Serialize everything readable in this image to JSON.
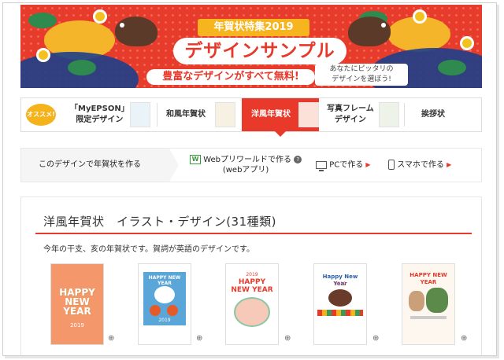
{
  "banner": {
    "tag": "年賀状特集2019",
    "title": "デザインサンプル",
    "subtitle": "豊富なデザインがすべて無料!",
    "note_line1": "あなたにピッタリの",
    "note_line2": "デザインを選ぼう!"
  },
  "tabs": {
    "badge": "オススメ!",
    "items": [
      {
        "label_line1": "「MyEPSON」",
        "label_line2": "限定デザイン"
      },
      {
        "label_line1": "和風年賀状",
        "label_line2": ""
      },
      {
        "label_line1": "洋風年賀状",
        "label_line2": ""
      },
      {
        "label_line1": "写真フレーム",
        "label_line2": "デザイン"
      },
      {
        "label_line1": "挨拶状",
        "label_line2": ""
      }
    ],
    "active_index": 2
  },
  "create": {
    "label": "このデザインで年賀状を作る",
    "web_line1": "Webプリワールドで作る",
    "web_line2": "(webアプリ)",
    "pc": "PCで作る",
    "smartphone": "スマホで作る"
  },
  "section": {
    "title": "洋風年賀状　イラスト・デザイン(31種類)",
    "description": "今年の干支、亥の年賀状です。賀詞が英語のデザインです。",
    "cards": [
      {
        "headline": "HAPPY NEW YEAR",
        "year": "2019"
      },
      {
        "headline": "HAPPY NEW YEAR",
        "year": "2019"
      },
      {
        "headline": "HAPPY NEW YEAR",
        "year": "2019"
      },
      {
        "headline": "Happy New Year",
        "year": "2019"
      },
      {
        "headline": "HAPPY NEW YEAR",
        "year": ""
      }
    ]
  },
  "icons": {
    "zoom": "magnifier-icon",
    "web": "web-app-icon",
    "help": "question-icon",
    "pc": "pc-icon",
    "smartphone": "smartphone-icon",
    "arrow": "triangle-right-icon"
  },
  "colors": {
    "accent_red": "#e8392b",
    "banner_red": "#e73b2b",
    "badge_yellow": "#f4b21b",
    "banner_blue": "#1d3f8a"
  }
}
